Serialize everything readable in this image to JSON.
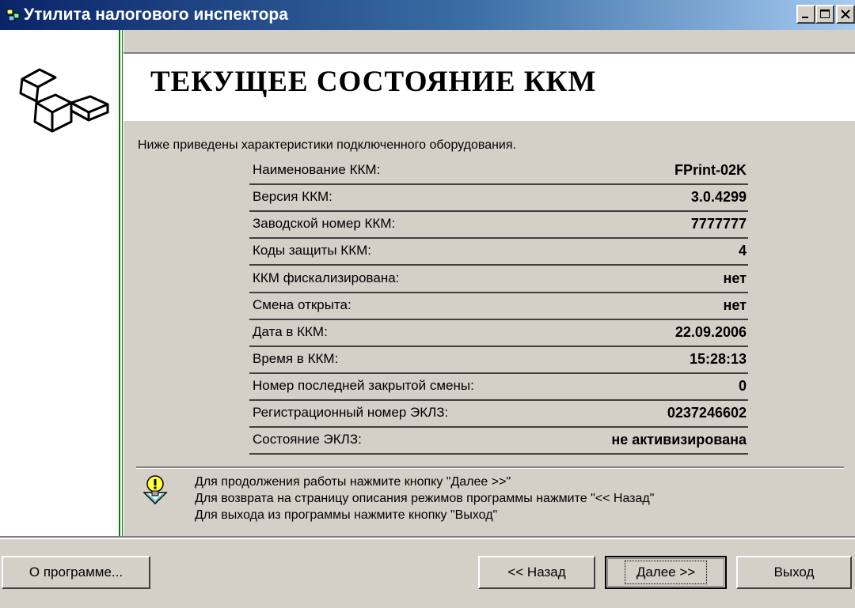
{
  "window": {
    "title": "Утилита налогового инспектора"
  },
  "header": {
    "title": "ТЕКУЩЕЕ СОСТОЯНИЕ ККМ"
  },
  "intro_text": "Ниже приведены характеристики подключенного оборудования.",
  "properties": [
    {
      "label": "Наименование ККМ:",
      "value": "FPrint-02K"
    },
    {
      "label": "Версия ККМ:",
      "value": "3.0.4299"
    },
    {
      "label": "Заводской номер ККМ:",
      "value": "7777777"
    },
    {
      "label": "Коды защиты ККМ:",
      "value": "4"
    },
    {
      "label": "ККМ фискализирована:",
      "value": "нет"
    },
    {
      "label": "Смена открыта:",
      "value": "нет"
    },
    {
      "label": "Дата в ККМ:",
      "value": "22.09.2006"
    },
    {
      "label": "Время в ККМ:",
      "value": "15:28:13"
    },
    {
      "label": "Номер последней закрытой смены:",
      "value": "0"
    },
    {
      "label": "Регистрационный номер ЭКЛЗ:",
      "value": "0237246602"
    },
    {
      "label": "Состояние ЭКЛЗ:",
      "value": "не активизирована"
    }
  ],
  "hints": [
    "Для продолжения работы нажмите кнопку \"Далее >>\"",
    "Для возврата на страницу описания режимов программы нажмите \"<< Назад\"",
    "Для выхода из программы нажмите кнопку \"Выход\""
  ],
  "buttons": {
    "about": "О программе...",
    "back": "<< Назад",
    "next": "Далее >>",
    "exit": "Выход"
  },
  "icons": {
    "app": "app-icon",
    "logo": "cubes-logo-icon",
    "hint": "lightbulb-hint-icon",
    "minimize": "minimize-icon",
    "maximize": "maximize-icon",
    "close": "close-icon"
  }
}
